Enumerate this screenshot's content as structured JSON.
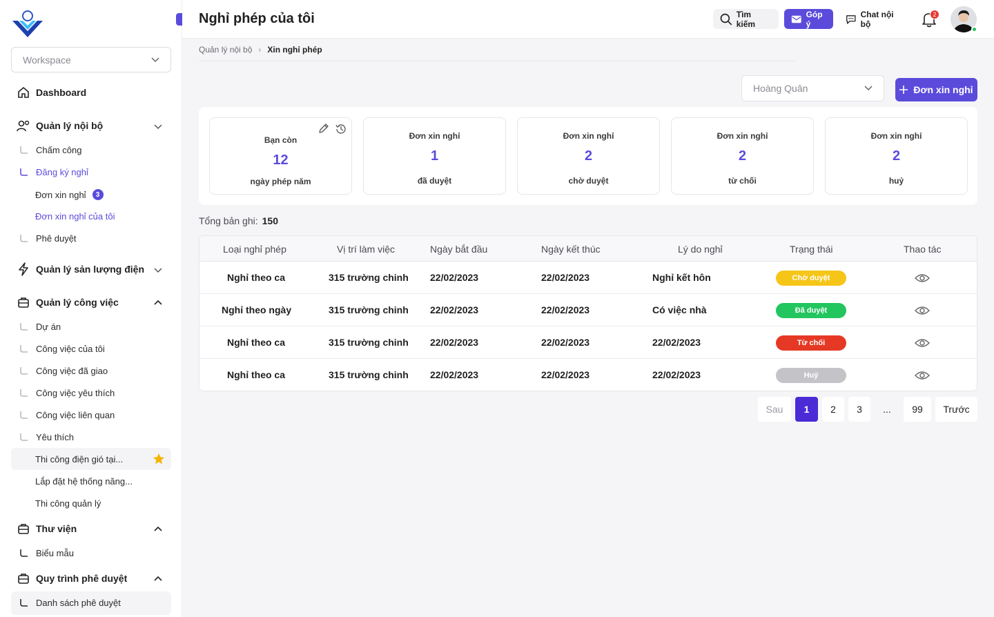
{
  "sidebar": {
    "workspace": "Workspace",
    "dashboard": "Dashboard",
    "internal": "Quản lý nội bộ",
    "timekeeping": "Chấm công",
    "leave_register": "Đăng ký nghỉ",
    "leave_requests": "Đơn xin nghỉ",
    "leave_requests_count": "3",
    "my_leave_requests": "Đơn xin nghỉ của tôi",
    "approval": "Phê duyệt",
    "power_output": "Quản lý sản lượng điện",
    "work": "Quản lý công việc",
    "projects": "Dự án",
    "my_tasks": "Công việc của tôi",
    "assigned_tasks": "Công việc đã giao",
    "fav_tasks": "Công việc yêu thích",
    "related_tasks": "Công việc liên quan",
    "favorites": "Yêu thích",
    "fav_items": [
      "Thi công điện gió tại...",
      "Lắp đặt hệ thống năng...",
      "Thi công quản lý"
    ],
    "library": "Thư viện",
    "forms": "Biểu mẫu",
    "approval_flow": "Quy trình phê duyệt",
    "approval_list": "Danh sách phê duyệt"
  },
  "header": {
    "title": "Nghỉ phép của tôi",
    "search": "Tìm kiếm",
    "feedback": "Góp ý",
    "chat": "Chat nội bộ",
    "notif_count": "2"
  },
  "breadcrumb": {
    "parent": "Quản lý nội bộ",
    "current": "Xin nghỉ phép"
  },
  "filter": {
    "user": "Hoàng Quân",
    "add_label": "Đơn xin nghỉ"
  },
  "stats": [
    {
      "top": "Bạn còn",
      "num": "12",
      "bot": "ngày phép năm"
    },
    {
      "top": "Đơn xin nghỉ",
      "num": "1",
      "bot": "đã duyệt"
    },
    {
      "top": "Đơn xin nghỉ",
      "num": "2",
      "bot": "chờ duyệt"
    },
    {
      "top": "Đơn xin nghỉ",
      "num": "2",
      "bot": "từ chối"
    },
    {
      "top": "Đơn xin nghỉ",
      "num": "2",
      "bot": "huỷ"
    }
  ],
  "total": {
    "label": "Tổng bản ghi:",
    "value": "150"
  },
  "table": {
    "headers": [
      "Loại nghỉ phép",
      "Vị trí làm việc",
      "Ngày bắt đầu",
      "Ngày kết thúc",
      "Lý do nghỉ",
      "Trạng thái",
      "Thao tác"
    ],
    "rows": [
      {
        "type": "Nghỉ theo ca",
        "location": "315 trường chinh",
        "start": "22/02/2023",
        "end": "22/02/2023",
        "reason": "Nghỉ kết hôn",
        "status": "Chờ duyệt",
        "status_color": "#f5c518"
      },
      {
        "type": "Nghỉ theo ngày",
        "location": "315 trường chinh",
        "start": "22/02/2023",
        "end": "22/02/2023",
        "reason": "Có việc nhà",
        "status": "Đã duyệt",
        "status_color": "#22c55e"
      },
      {
        "type": "Nghỉ theo ca",
        "location": "315 trường chinh",
        "start": "22/02/2023",
        "end": "22/02/2023",
        "reason": "22/02/2023",
        "status": "Từ chối",
        "status_color": "#e53925"
      },
      {
        "type": "Nghỉ theo ca",
        "location": "315 trường chinh",
        "start": "22/02/2023",
        "end": "22/02/2023",
        "reason": "22/02/2023",
        "status": "Huỷ",
        "status_color": "#c4c4c8"
      }
    ]
  },
  "pagination": {
    "next": "Sau",
    "pages": [
      "1",
      "2",
      "3",
      "...",
      "99"
    ],
    "prev": "Trước"
  },
  "colors": {
    "accent": "#5b4bdb"
  }
}
